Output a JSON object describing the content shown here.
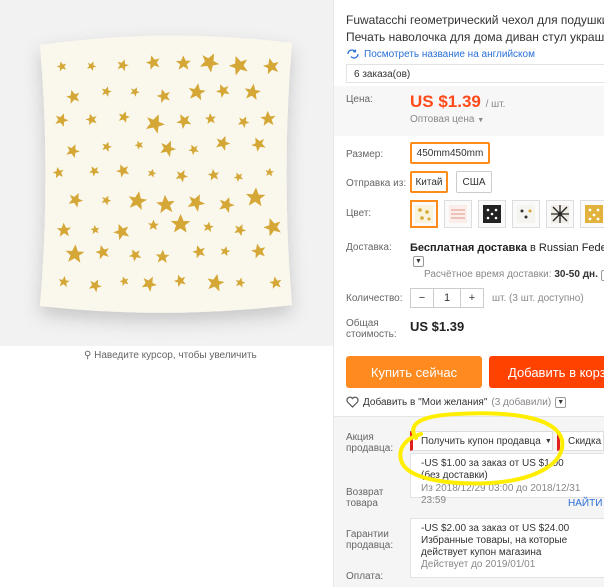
{
  "gallery": {
    "zoom_hint": "Наведите курсор, чтобы увеличить",
    "colors": {
      "pillow": "#faf7ec",
      "star": "#d4a736",
      "background": "#f2f2f2"
    }
  },
  "product": {
    "title_line1": "Fuwatacchi геометрический чехол для подушки C",
    "title_line2": "Печать наволочка для дома диван стул украшен",
    "translate_link": "Посмотреть название на английском",
    "orders": "6 заказа(ов)"
  },
  "price": {
    "label": "Цена:",
    "value": "US $1.39",
    "unit": "/ шт.",
    "wholesale": "Оптовая цена",
    "color": "#ff4a1a"
  },
  "options": {
    "size_label": "Размер:",
    "size_value": "450mm450mm",
    "ship_from_label": "Отправка из:",
    "ship_from": [
      "Китай",
      "США"
    ],
    "color_label": "Цвет:",
    "swatches": [
      "yellow-stars",
      "pink-stripes",
      "black-pattern",
      "white-dots",
      "black-diamonds",
      "yellow-dots"
    ]
  },
  "shipping": {
    "label": "Доставка:",
    "free": "Бесплатная доставка",
    "to": "в Russian Federation",
    "eta_label": "Расчётное время доставки:",
    "eta_value": "30-50",
    "eta_unit": "дн."
  },
  "quantity": {
    "label": "Количество:",
    "minus": "−",
    "value": "1",
    "plus": "+",
    "available": "шт. (3 шт. доступно)"
  },
  "total": {
    "label_line1": "Общая",
    "label_line2": "стоимость:",
    "value": "US $1.39"
  },
  "actions": {
    "buy": "Купить сейчас",
    "cart": "Добавить в корз",
    "wishlist": "Добавить в \"Мои желания\"",
    "wishlist_count": "(3 добавили)",
    "buy_color": "#ff8a1f",
    "cart_color": "#ff4200"
  },
  "promo": {
    "label_line1": "Акция",
    "label_line2": "продавца:",
    "coupon_button": "Получить купон продавца",
    "discount_tab": "Скидка U",
    "coupon1_line1": "-US $1.00 за заказ от US $1.00",
    "coupon1_line2": "(без доставки)",
    "coupon1_validity": "Из 2018/12/29 03:00 до 2018/12/31 23:59",
    "find_link": "НАЙТИ И",
    "coupon2_line1": "-US $2.00 за заказ от US $24.00",
    "coupon2_line2": "Избранные товары, на которые",
    "coupon2_line3": "действует купон магазина",
    "coupon2_validity": "Действует до 2019/01/01"
  },
  "side_labels": {
    "return_line1": "Возврат",
    "return_line2": "товара",
    "guarantee_line1": "Гарантии",
    "guarantee_line2": "продавца:",
    "payment": "Оплата:"
  },
  "highlight_color": "#ffee00"
}
